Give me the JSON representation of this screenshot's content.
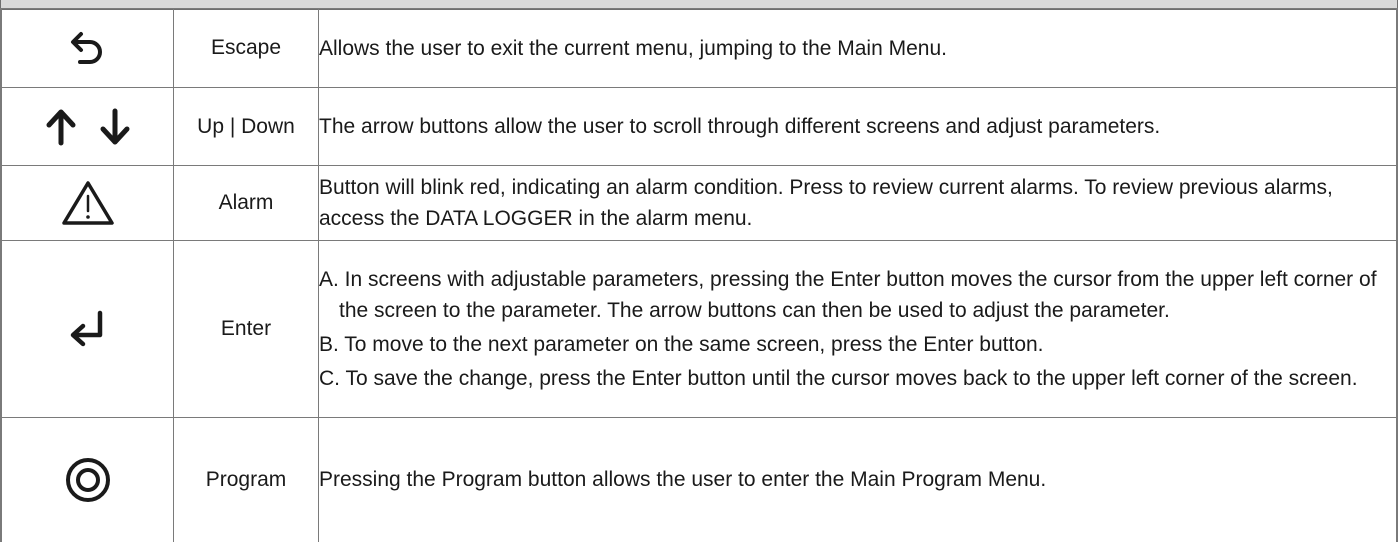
{
  "rows": [
    {
      "icon": "escape-back-arrow-icon",
      "name": "Escape",
      "description": "Allows the user to exit the current menu, jumping to the Main Menu."
    },
    {
      "icon": "up-down-arrows-icon",
      "name": "Up | Down",
      "description": "The arrow buttons allow the user to scroll through different screens and adjust parameters."
    },
    {
      "icon": "alarm-warning-triangle-icon",
      "name": "Alarm",
      "description": "Button will blink red, indicating an alarm condition. Press to review current alarms. To review previous alarms, access the DATA LOGGER in the alarm menu."
    },
    {
      "icon": "enter-return-arrow-icon",
      "name": "Enter",
      "steps": [
        "A. In screens with adjustable parameters, pressing the Enter button moves the cursor from the upper left corner of the screen to the parameter. The arrow buttons can then be used to adjust the parameter.",
        "B. To move to the next parameter on the same screen, press the Enter button.",
        "C. To save the change, press the Enter button until the cursor moves back to the upper left corner of the screen."
      ]
    },
    {
      "icon": "program-circle-icon",
      "name": "Program",
      "description": "Pressing the Program button allows the user to enter the Main Program Menu."
    }
  ],
  "colors": {
    "border": "#7a7a7a",
    "header_band": "#d9d9d9",
    "text": "#1a1a1a"
  }
}
